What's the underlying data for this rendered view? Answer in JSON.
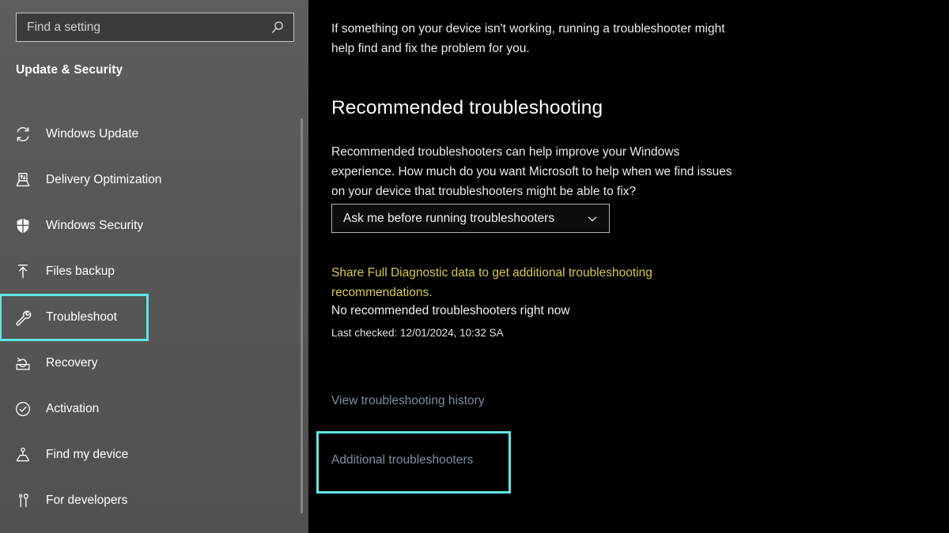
{
  "search": {
    "placeholder": "Find a setting",
    "value": "",
    "icon": "search-icon"
  },
  "sidebar": {
    "section_title": "Update & Security",
    "highlight_color": "#5fe6e6",
    "items": [
      {
        "label": "Windows Update",
        "icon": "sync-refresh-icon",
        "selected": false
      },
      {
        "label": "Delivery Optimization",
        "icon": "delivery-upload-icon",
        "selected": false
      },
      {
        "label": "Windows Security",
        "icon": "shield-icon",
        "selected": false
      },
      {
        "label": "Files backup",
        "icon": "upload-arrow-icon",
        "selected": false
      },
      {
        "label": "Troubleshoot",
        "icon": "wrench-icon",
        "selected": true
      },
      {
        "label": "Recovery",
        "icon": "recovery-restore-icon",
        "selected": false
      },
      {
        "label": "Activation",
        "icon": "check-circle-icon",
        "selected": false
      },
      {
        "label": "Find my device",
        "icon": "location-person-icon",
        "selected": false
      },
      {
        "label": "For developers",
        "icon": "tools-icon",
        "selected": false
      }
    ]
  },
  "main": {
    "intro": "If something on your device isn't working, running a troubleshooter might help find and fix the problem for you.",
    "heading": "Recommended troubleshooting",
    "description": "Recommended troubleshooters can help improve your Windows experience. How much do you want Microsoft to help when we find issues on your device that troubleshooters might be able to fix?",
    "dropdown": {
      "value": "Ask me before running troubleshooters",
      "icon": "chevron-down-icon",
      "options": [
        "Ask me before running troubleshooters"
      ]
    },
    "diagnostic_link": "Share Full Diagnostic data to get additional troubleshooting recommendations.",
    "diagnostic_link_color": "#d8c84a",
    "status": "No recommended troubleshooters right now",
    "last_checked": "Last checked: 12/01/2024, 10:32 SA",
    "links": {
      "history": "View troubleshooting history",
      "additional": "Additional troubleshooters"
    },
    "link_color": "#7d8c9e",
    "highlight_color": "#5fe6e6"
  }
}
